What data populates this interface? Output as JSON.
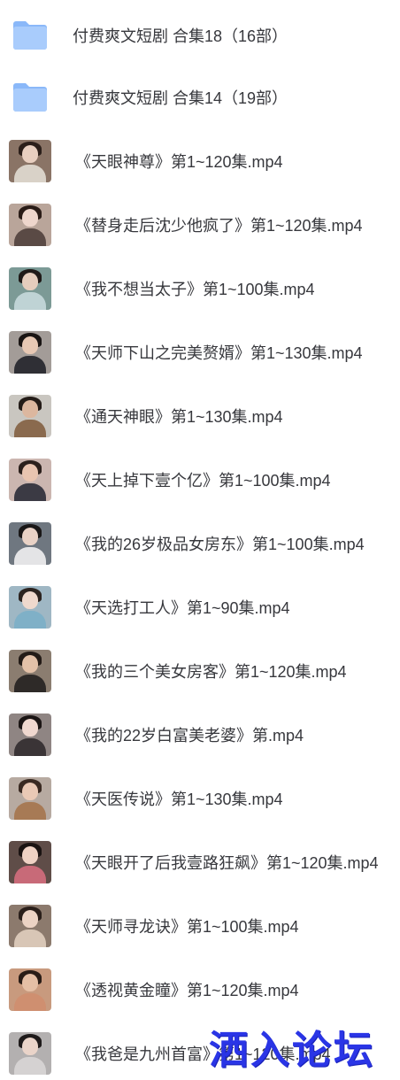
{
  "folders": [
    {
      "name": "付费爽文短剧 合集18（16部）",
      "icon": "folder-icon"
    },
    {
      "name": "付费爽文短剧 合集14（19部）",
      "icon": "folder-icon"
    }
  ],
  "files": [
    {
      "name": "《天眼神尊》第1~120集.mp4",
      "thumb": {
        "bg": "#8a7466",
        "hair": "#2b1f1a",
        "skin": "#e8cfc0",
        "cloth": "#d9d2c8"
      }
    },
    {
      "name": "《替身走后沈少他疯了》第1~120集.mp4",
      "thumb": {
        "bg": "#b9a59a",
        "hair": "#2a1c17",
        "skin": "#eed6cc",
        "cloth": "#5a4a45"
      }
    },
    {
      "name": "《我不想当太子》第1~100集.mp4",
      "thumb": {
        "bg": "#7c9a96",
        "hair": "#1f1a18",
        "skin": "#e5cdbd",
        "cloth": "#bfd3d5"
      }
    },
    {
      "name": "《天师下山之完美赘婿》第1~130集.mp4",
      "thumb": {
        "bg": "#a39c98",
        "hair": "#1a1514",
        "skin": "#e7c8b4",
        "cloth": "#2f2f35"
      }
    },
    {
      "name": "《通天神眼》第1~130集.mp4",
      "thumb": {
        "bg": "#c9c6c0",
        "hair": "#241c18",
        "skin": "#dcb79f",
        "cloth": "#8a6a4e"
      }
    },
    {
      "name": "《天上掉下壹个亿》第1~100集.mp4",
      "thumb": {
        "bg": "#cbb6b0",
        "hair": "#2b201c",
        "skin": "#e8c4b0",
        "cloth": "#3b3a44"
      }
    },
    {
      "name": "《我的26岁极品女房东》第1~100集.mp4",
      "thumb": {
        "bg": "#6f7780",
        "hair": "#191717",
        "skin": "#e9d2c6",
        "cloth": "#e4e4e6"
      }
    },
    {
      "name": "《天选打工人》第1~90集.mp4",
      "thumb": {
        "bg": "#9fb7c4",
        "hair": "#2c2420",
        "skin": "#efd9cd",
        "cloth": "#7fb0c7"
      }
    },
    {
      "name": "《我的三个美女房客》第1~120集.mp4",
      "thumb": {
        "bg": "#8b7d70",
        "hair": "#231b17",
        "skin": "#e3c1a8",
        "cloth": "#2e2a28"
      }
    },
    {
      "name": "《我的22岁白富美老婆》第.mp4",
      "thumb": {
        "bg": "#8f8583",
        "hair": "#1b1514",
        "skin": "#f0d8cf",
        "cloth": "#3a3436"
      }
    },
    {
      "name": "《天医传说》第1~130集.mp4",
      "thumb": {
        "bg": "#b7aaa1",
        "hair": "#3a2a22",
        "skin": "#eac9b5",
        "cloth": "#a77a55"
      }
    },
    {
      "name": "《天眼开了后我壹路狂飙》第1~120集.mp4",
      "thumb": {
        "bg": "#5f4d48",
        "hair": "#1a1312",
        "skin": "#efd2c4",
        "cloth": "#c86a78"
      }
    },
    {
      "name": "《天师寻龙诀》第1~100集.mp4",
      "thumb": {
        "bg": "#8c7a6d",
        "hair": "#2a1f1a",
        "skin": "#ecd3c4",
        "cloth": "#d8c6b6"
      }
    },
    {
      "name": "《透视黄金瞳》第1~120集.mp4",
      "thumb": {
        "bg": "#c89a7e",
        "hair": "#2a1d17",
        "skin": "#e5bfa5",
        "cloth": "#cf8f70"
      }
    },
    {
      "name": "《我爸是九州首富》第1~120集.mp4",
      "thumb": {
        "bg": "#b3b0b0",
        "hair": "#1e1a1a",
        "skin": "#ead4c9",
        "cloth": "#d5d2d2"
      }
    }
  ],
  "watermark": "洒入论坛",
  "colors": {
    "folder_back": "#8ab8f9",
    "folder_front": "#a9ccfc",
    "text": "#37383d",
    "watermark": "#2a35e6"
  }
}
